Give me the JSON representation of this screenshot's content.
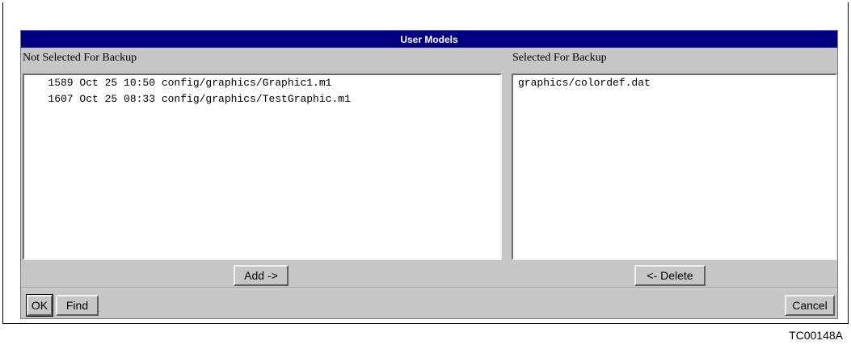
{
  "dialog": {
    "title": "User Models",
    "left_panel": {
      "label": "Not Selected For Backup",
      "items": [
        "   1589 Oct 25 10:50 config/graphics/Graphic1.m1",
        "   1607 Oct 25 08:33 config/graphics/TestGraphic.m1"
      ]
    },
    "right_panel": {
      "label": "Selected For Backup",
      "items": [
        "graphics/colordef.dat"
      ]
    },
    "buttons": {
      "add": "Add ->",
      "delete": "<- Delete",
      "ok": "OK",
      "find": "Find",
      "cancel": "Cancel"
    }
  },
  "figure_code": "TC00148A",
  "colors": {
    "titlebar": "#000080",
    "dialog_bg": "#c6c6c6",
    "list_bg": "#ffffff"
  }
}
